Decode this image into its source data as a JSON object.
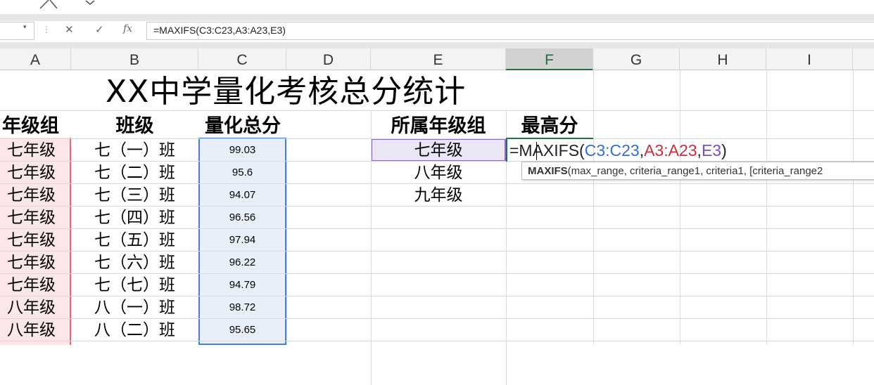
{
  "formula_bar": {
    "formula": "=MAXIFS(C3:C23,A3:A23,E3)",
    "cancel_icon": "✕",
    "enter_icon": "✓",
    "fx_label": "fx"
  },
  "columns": [
    "A",
    "B",
    "C",
    "D",
    "E",
    "F",
    "G",
    "H",
    "I"
  ],
  "selected_column": "F",
  "title": "XX中学量化考核总分统计",
  "headers": {
    "grade_group": "年级组",
    "class": "班级",
    "total_score": "量化总分",
    "belongs_grade_group": "所属年级组",
    "max_score": "最高分"
  },
  "rows": [
    {
      "grade": "七年级",
      "class": "七（一）班",
      "score": "99.03"
    },
    {
      "grade": "七年级",
      "class": "七（二）班",
      "score": "95.6"
    },
    {
      "grade": "七年级",
      "class": "七（三）班",
      "score": "94.07"
    },
    {
      "grade": "七年级",
      "class": "七（四）班",
      "score": "96.56"
    },
    {
      "grade": "七年级",
      "class": "七（五）班",
      "score": "97.94"
    },
    {
      "grade": "七年级",
      "class": "七（六）班",
      "score": "96.22"
    },
    {
      "grade": "七年级",
      "class": "七（七）班",
      "score": "94.79"
    },
    {
      "grade": "八年级",
      "class": "八（一）班",
      "score": "98.72"
    },
    {
      "grade": "八年级",
      "class": "八（二）班",
      "score": "95.65"
    }
  ],
  "grade_list": [
    "七年级",
    "八年级",
    "九年级"
  ],
  "editor": {
    "prefix": "=MAXIFS(",
    "arg1": "C3:C23",
    "comma1": ",",
    "arg2": "A3:A23",
    "comma2": ",",
    "arg3": "E3",
    "suffix": ")"
  },
  "tooltip": {
    "fn": "MAXIFS",
    "args": "(max_range, criteria_range1, criteria1, [criteria_range2"
  },
  "colors": {
    "arg1": "#2f6fd6",
    "arg2": "#c8303a",
    "arg3": "#7a4fc0",
    "selection": "#217346"
  }
}
